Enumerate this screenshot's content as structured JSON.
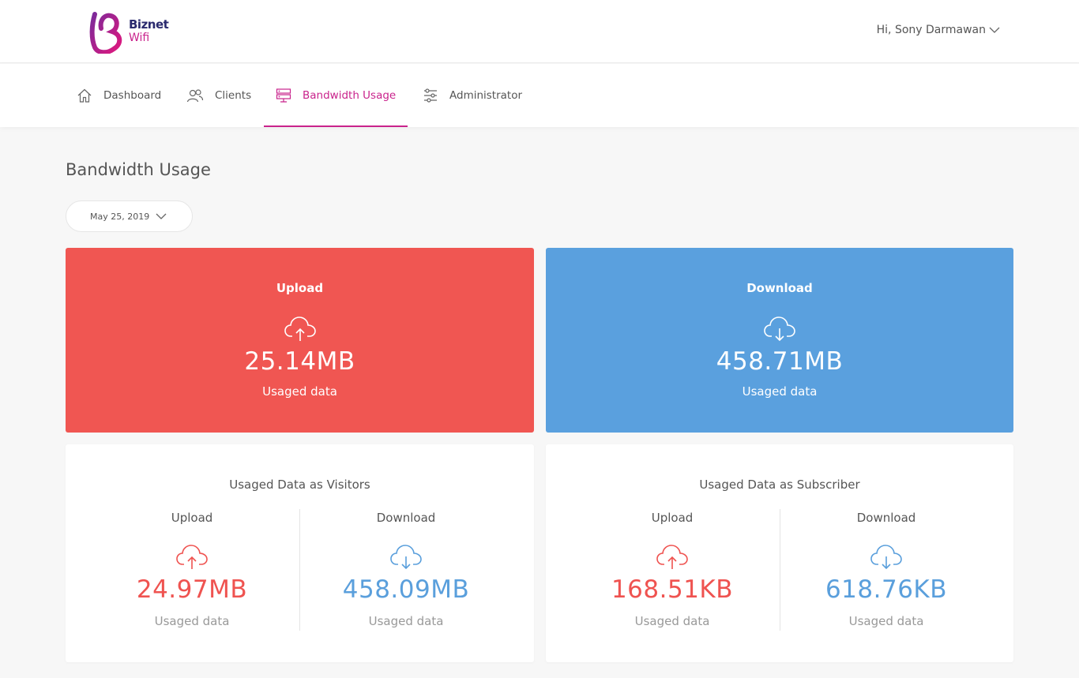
{
  "header": {
    "brand_line1": "Biznet",
    "brand_line2": "Wifi",
    "user_greeting": "Hi, Sony Darmawan"
  },
  "nav": {
    "items": [
      {
        "label": "Dashboard",
        "icon": "home-icon"
      },
      {
        "label": "Clients",
        "icon": "users-icon"
      },
      {
        "label": "Bandwidth Usage",
        "icon": "server-icon",
        "active": true
      },
      {
        "label": "Administrator",
        "icon": "sliders-icon"
      }
    ]
  },
  "page": {
    "title": "Bandwidth Usage",
    "date": "May 25, 2019"
  },
  "colors": {
    "accent": "#c9238c",
    "upload": "#f05652",
    "download": "#5aa0de"
  },
  "summary": {
    "upload": {
      "title": "Upload",
      "value": "25.14MB",
      "label": "Usaged data"
    },
    "download": {
      "title": "Download",
      "value": "458.71MB",
      "label": "Usaged data"
    }
  },
  "visitors": {
    "title": "Usaged Data as Visitors",
    "upload": {
      "title": "Upload",
      "value": "24.97MB",
      "label": "Usaged data"
    },
    "download": {
      "title": "Download",
      "value": "458.09MB",
      "label": "Usaged data"
    }
  },
  "subscriber": {
    "title": "Usaged Data as Subscriber",
    "upload": {
      "title": "Upload",
      "value": "168.51KB",
      "label": "Usaged data"
    },
    "download": {
      "title": "Download",
      "value": "618.76KB",
      "label": "Usaged data"
    }
  }
}
